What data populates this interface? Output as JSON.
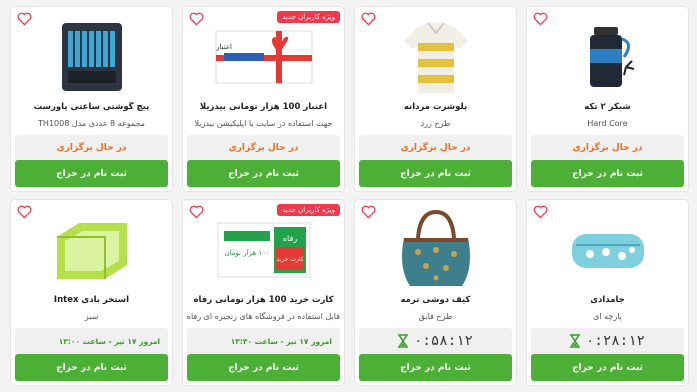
{
  "colors": {
    "accent_green": "#4caf36",
    "status_orange": "#f06e1e",
    "badge_red": "#ef394e",
    "heart_red": "#ef394e",
    "time_green": "#3a9b2a"
  },
  "row1": [
    {
      "name": "شیکر ۲ تکه",
      "sub": "Hard Core",
      "status": "در حال برگزاری",
      "cta": "ثبت نام در حراج",
      "image_icon": "shaker-bottle-icon"
    },
    {
      "name": "پلوشرت مردانه",
      "sub": "طرح زرد",
      "status": "در حال برگزاری",
      "cta": "ثبت نام در حراج",
      "image_icon": "polo-shirt-icon"
    },
    {
      "name": "اعتبار 100 هزار تومانی بیدزیلا",
      "sub": "جهت استفاده در سایت یا اپلیکیشن بیدزیلا",
      "status": "در حال برگزاری",
      "cta": "ثبت نام در حراج",
      "badge": "ویژه کاربران جدید",
      "image_icon": "gift-voucher-icon",
      "voucher_text": "اعتبار"
    },
    {
      "name": "پیچ گوشتی ساعتی پاورست",
      "sub": "مجموعه 8 عددی مدل TH1008",
      "status": "در حال برگزاری",
      "cta": "ثبت نام در حراج",
      "image_icon": "screwdriver-set-icon"
    }
  ],
  "row2": [
    {
      "name": "جامدادی",
      "sub": "پارچه ای",
      "timer": "۰:۲۸:۱۲",
      "cta": "ثبت نام در حراج",
      "image_icon": "pencil-case-icon"
    },
    {
      "name": "کیف دوشی ترمه",
      "sub": "طرح قایق",
      "timer": "۰:۵۸:۱۲",
      "cta": "ثبت نام در حراج",
      "image_icon": "handbag-icon"
    },
    {
      "name": "کارت خرید 100 هزار تومانی رفاه",
      "sub": "قابل استفاده در فروشگاه های زنجیره ای رفاه",
      "time_text": "امروز ۱۷ تیر - ساعت ۱۳:۳۰",
      "cta": "ثبت نام در حراج",
      "badge": "ویژه کاربران جدید",
      "image_icon": "gift-card-icon",
      "card_line1": "رفاه",
      "card_line2": "۱۰۰ هزار تومان",
      "card_line3": "کارت خرید"
    },
    {
      "name": "استخر بادی Intex",
      "sub": "سبز",
      "time_text": "امروز ۱۷ تیر - ساعت ۱۳:۰۰",
      "cta": "ثبت نام در حراج",
      "image_icon": "inflatable-pool-icon"
    }
  ]
}
